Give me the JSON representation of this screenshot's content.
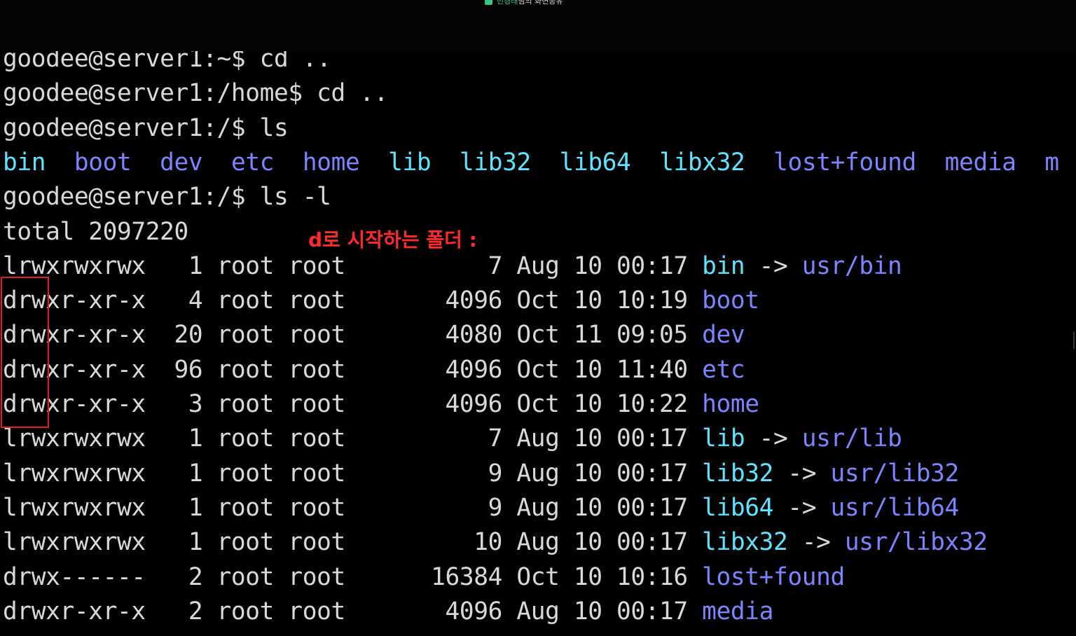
{
  "share_bar": {
    "presenter": "민경태",
    "suffix": "님의 화면공유"
  },
  "annotation": {
    "text": "d로 시작하는 폴더 :"
  },
  "colors": {
    "background": "#000000",
    "text": "#d9d9d9",
    "directory": "#7d84ff",
    "symlink": "#5ee4ff",
    "annotation": "#ff2a2a"
  },
  "terminal_lines": [
    {
      "segments": [
        {
          "text": "goodee@server1:~$ cd .."
        }
      ]
    },
    {
      "segments": [
        {
          "text": "goodee@server1:/home$ cd .."
        }
      ]
    },
    {
      "segments": [
        {
          "text": "goodee@server1:/$ ls"
        }
      ]
    },
    {
      "segments": [
        {
          "text": "bin",
          "style": "cyan"
        },
        {
          "text": "  "
        },
        {
          "text": "boot",
          "style": "blue"
        },
        {
          "text": "  "
        },
        {
          "text": "dev",
          "style": "blue"
        },
        {
          "text": "  "
        },
        {
          "text": "etc",
          "style": "blue"
        },
        {
          "text": "  "
        },
        {
          "text": "home",
          "style": "blue"
        },
        {
          "text": "  "
        },
        {
          "text": "lib",
          "style": "cyan"
        },
        {
          "text": "  "
        },
        {
          "text": "lib32",
          "style": "cyan"
        },
        {
          "text": "  "
        },
        {
          "text": "lib64",
          "style": "cyan"
        },
        {
          "text": "  "
        },
        {
          "text": "libx32",
          "style": "cyan"
        },
        {
          "text": "  "
        },
        {
          "text": "lost+found",
          "style": "blue"
        },
        {
          "text": "  "
        },
        {
          "text": "media",
          "style": "blue"
        },
        {
          "text": "  "
        },
        {
          "text": "m",
          "style": "blue"
        }
      ]
    },
    {
      "segments": [
        {
          "text": "goodee@server1:/$ ls -l"
        }
      ]
    },
    {
      "segments": [
        {
          "text": "total 2097220"
        }
      ]
    },
    {
      "segments": [
        {
          "text": "lrwxrwxrwx   1 root root          7 Aug 10 00:17 "
        },
        {
          "text": "bin",
          "style": "cyan"
        },
        {
          "text": " -> "
        },
        {
          "text": "usr/bin",
          "style": "blue"
        }
      ]
    },
    {
      "segments": [
        {
          "text": "drwxr-xr-x   4 root root       4096 Oct 10 10:19 "
        },
        {
          "text": "boot",
          "style": "blue"
        }
      ]
    },
    {
      "segments": [
        {
          "text": "drwxr-xr-x  20 root root       4080 Oct 11 09:05 "
        },
        {
          "text": "dev",
          "style": "blue"
        }
      ]
    },
    {
      "segments": [
        {
          "text": "drwxr-xr-x  96 root root       4096 Oct 10 11:40 "
        },
        {
          "text": "etc",
          "style": "blue"
        }
      ]
    },
    {
      "segments": [
        {
          "text": "drwxr-xr-x   3 root root       4096 Oct 10 10:22 "
        },
        {
          "text": "home",
          "style": "blue"
        }
      ]
    },
    {
      "segments": [
        {
          "text": "lrwxrwxrwx   1 root root          7 Aug 10 00:17 "
        },
        {
          "text": "lib",
          "style": "cyan"
        },
        {
          "text": " -> "
        },
        {
          "text": "usr/lib",
          "style": "blue"
        }
      ]
    },
    {
      "segments": [
        {
          "text": "lrwxrwxrwx   1 root root          9 Aug 10 00:17 "
        },
        {
          "text": "lib32",
          "style": "cyan"
        },
        {
          "text": " -> "
        },
        {
          "text": "usr/lib32",
          "style": "blue"
        }
      ]
    },
    {
      "segments": [
        {
          "text": "lrwxrwxrwx   1 root root          9 Aug 10 00:17 "
        },
        {
          "text": "lib64",
          "style": "cyan"
        },
        {
          "text": " -> "
        },
        {
          "text": "usr/lib64",
          "style": "blue"
        }
      ]
    },
    {
      "segments": [
        {
          "text": "lrwxrwxrwx   1 root root         10 Aug 10 00:17 "
        },
        {
          "text": "libx32",
          "style": "cyan"
        },
        {
          "text": " -> "
        },
        {
          "text": "usr/libx32",
          "style": "blue"
        }
      ]
    },
    {
      "segments": [
        {
          "text": "drwx------   2 root root      16384 Oct 10 10:16 "
        },
        {
          "text": "lost+found",
          "style": "blue"
        }
      ]
    },
    {
      "segments": [
        {
          "text": "drwxr-xr-x   2 root root       4096 Aug 10 00:17 "
        },
        {
          "text": "media",
          "style": "blue"
        }
      ]
    }
  ]
}
